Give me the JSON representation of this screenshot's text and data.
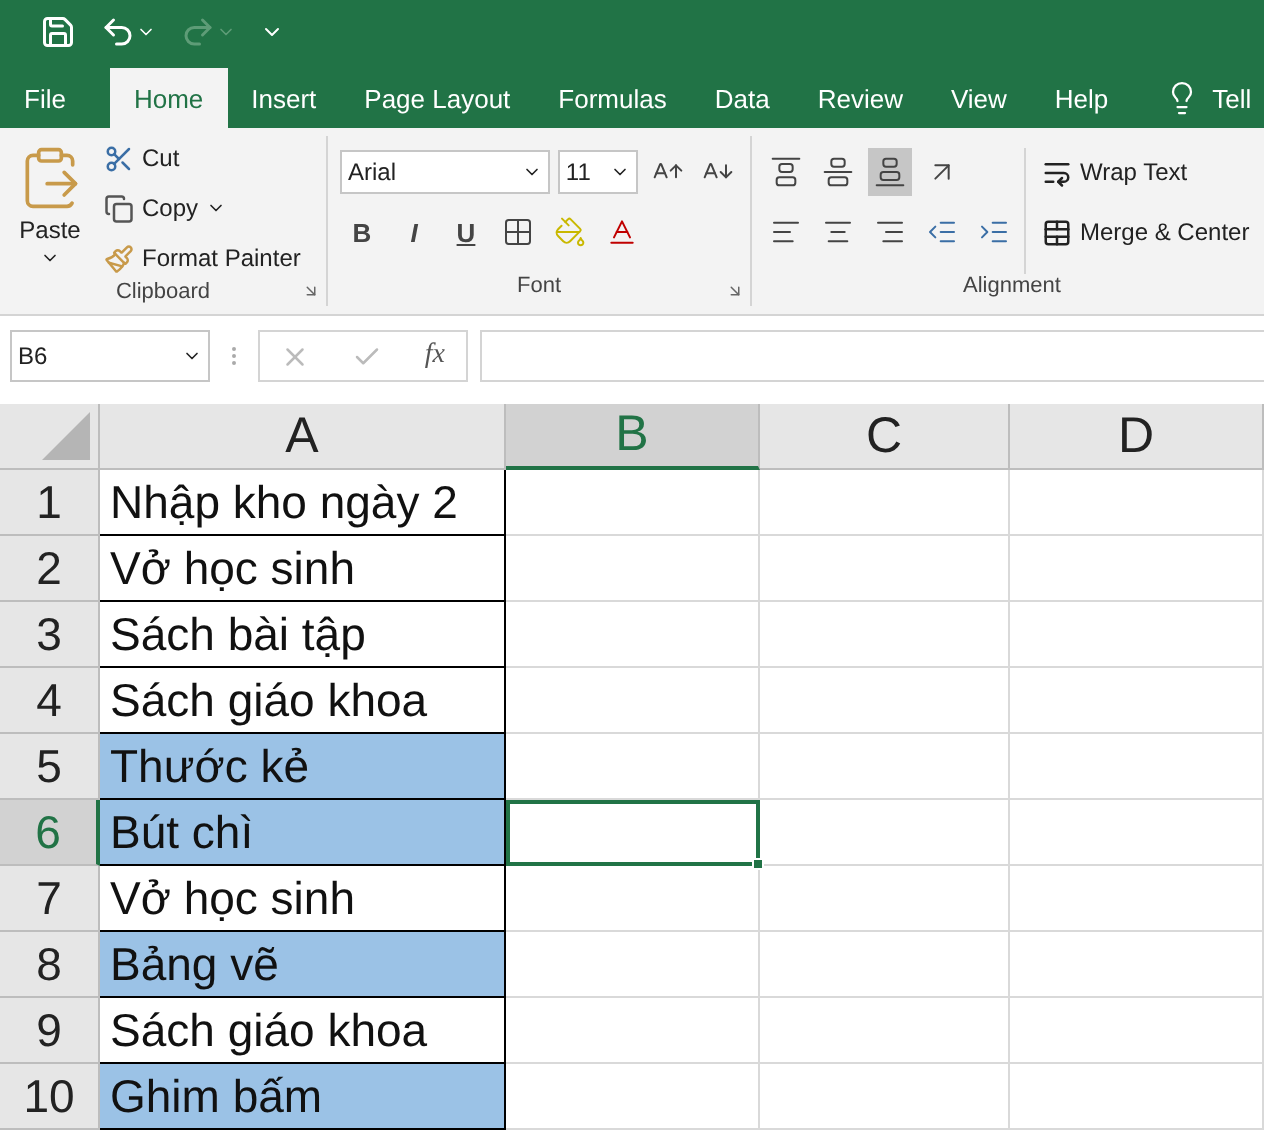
{
  "quick_access": {
    "undo_enabled": true,
    "redo_enabled": false
  },
  "tabs": [
    {
      "label": "File",
      "selected": false
    },
    {
      "label": "Home",
      "selected": true
    },
    {
      "label": "Insert",
      "selected": false
    },
    {
      "label": "Page Layout",
      "selected": false
    },
    {
      "label": "Formulas",
      "selected": false
    },
    {
      "label": "Data",
      "selected": false
    },
    {
      "label": "Review",
      "selected": false
    },
    {
      "label": "View",
      "selected": false
    },
    {
      "label": "Help",
      "selected": false
    }
  ],
  "tell_me": "Tell",
  "clipboard": {
    "paste": "Paste",
    "cut": "Cut",
    "copy": "Copy",
    "format_painter": "Format Painter",
    "title": "Clipboard"
  },
  "font": {
    "name": "Arial",
    "size": "11",
    "bold": "B",
    "italic": "I",
    "underline": "U",
    "title": "Font"
  },
  "alignment": {
    "wrap_text": "Wrap Text",
    "merge_center": "Merge & Center",
    "title": "Alignment",
    "bottom_align_on": true
  },
  "formula_bar": {
    "name_box": "B6",
    "fx": "fx"
  },
  "columns": [
    {
      "label": "A",
      "selected": false
    },
    {
      "label": "B",
      "selected": true
    },
    {
      "label": "C",
      "selected": false
    },
    {
      "label": "D",
      "selected": false
    }
  ],
  "rows": [
    {
      "number": "1",
      "text": "Nhập kho ngày 2",
      "highlighted": false,
      "selected": false
    },
    {
      "number": "2",
      "text": "Vở học sinh",
      "highlighted": false,
      "selected": false
    },
    {
      "number": "3",
      "text": "Sách bài tập",
      "highlighted": false,
      "selected": false
    },
    {
      "number": "4",
      "text": "Sách giáo khoa",
      "highlighted": false,
      "selected": false
    },
    {
      "number": "5",
      "text": "Thước kẻ",
      "highlighted": true,
      "selected": false
    },
    {
      "number": "6",
      "text": "Bút chì",
      "highlighted": true,
      "selected": true
    },
    {
      "number": "7",
      "text": "Vở học sinh",
      "highlighted": false,
      "selected": false
    },
    {
      "number": "8",
      "text": "Bảng vẽ",
      "highlighted": true,
      "selected": false
    },
    {
      "number": "9",
      "text": "Sách giáo khoa",
      "highlighted": false,
      "selected": false
    },
    {
      "number": "10",
      "text": "Ghim bấm",
      "highlighted": true,
      "selected": false
    }
  ]
}
